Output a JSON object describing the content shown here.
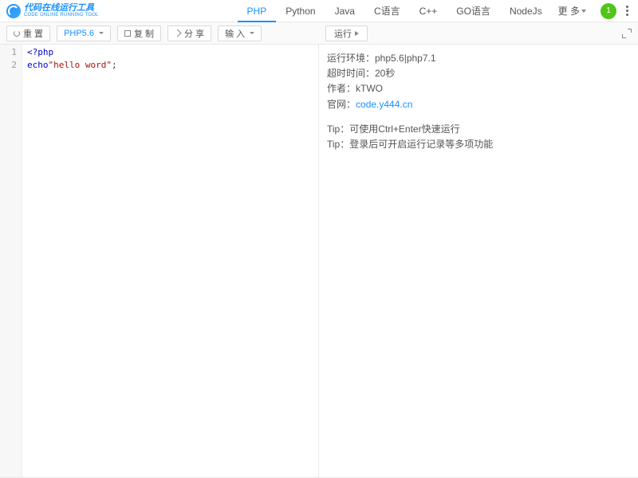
{
  "header": {
    "logo_cn": "代码在线运行工具",
    "logo_en": "CODE ONLINE RUNNING TOOL",
    "tabs": [
      "PHP",
      "Python",
      "Java",
      "C语言",
      "C++",
      "GO语言",
      "NodeJs"
    ],
    "active_tab": 0,
    "more_label": "更 多",
    "avatar_text": "1"
  },
  "toolbar": {
    "reset": "重 置",
    "version": "PHP5.6",
    "copy": "复 制",
    "share": "分 享",
    "input": "输 入",
    "run": "运行"
  },
  "editor": {
    "lines": [
      {
        "num": "1",
        "plain": "<?php"
      },
      {
        "num": "2",
        "plain": "echo\"hello word\";"
      }
    ]
  },
  "output": {
    "env": "运行环境：php5.6|php7.1",
    "timeout": "超时时间：20秒",
    "author": "作者：kTWO",
    "site_label": "官网：",
    "site_link": "code.y444.cn",
    "tip1": "Tip：可使用Ctrl+Enter快速运行",
    "tip2": "Tip：登录后可开启运行记录等多项功能"
  }
}
